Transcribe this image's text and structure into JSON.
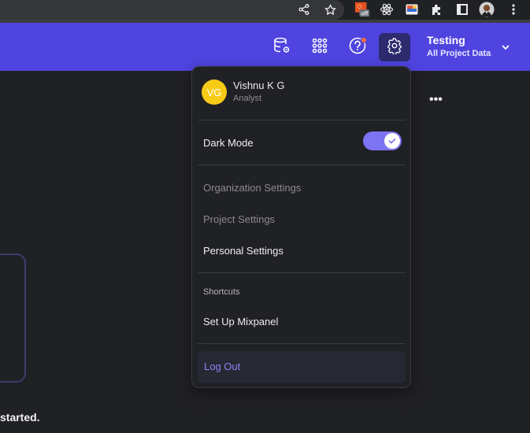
{
  "browser": {
    "toolbar_icons": [
      "share-icon",
      "bookmark-star-icon",
      "extension-off-icon",
      "react-devtools-icon",
      "extension-color-icon",
      "extensions-puzzle-icon",
      "sidebar-icon",
      "profile-avatar",
      "chrome-menu-icon"
    ],
    "ext_off_label": "off"
  },
  "header": {
    "icons": [
      "data-management-icon",
      "apps-grid-icon",
      "help-icon",
      "settings-icon"
    ],
    "project_name": "Testing",
    "project_scope": "All Project Data",
    "accent_color": "#4f44e0"
  },
  "background": {
    "more_label": "•••",
    "started_text": "started."
  },
  "menu": {
    "user": {
      "initials": "VG",
      "name": "Vishnu K G",
      "role": "Analyst"
    },
    "dark_mode": {
      "label": "Dark Mode",
      "enabled": true
    },
    "settings_items": [
      {
        "label": "Organization Settings",
        "enabled": false
      },
      {
        "label": "Project Settings",
        "enabled": false
      },
      {
        "label": "Personal Settings",
        "enabled": true
      }
    ],
    "shortcuts_heading": "Shortcuts",
    "shortcuts": [
      {
        "label": "Set Up Mixpanel"
      }
    ],
    "logout_label": "Log Out"
  }
}
